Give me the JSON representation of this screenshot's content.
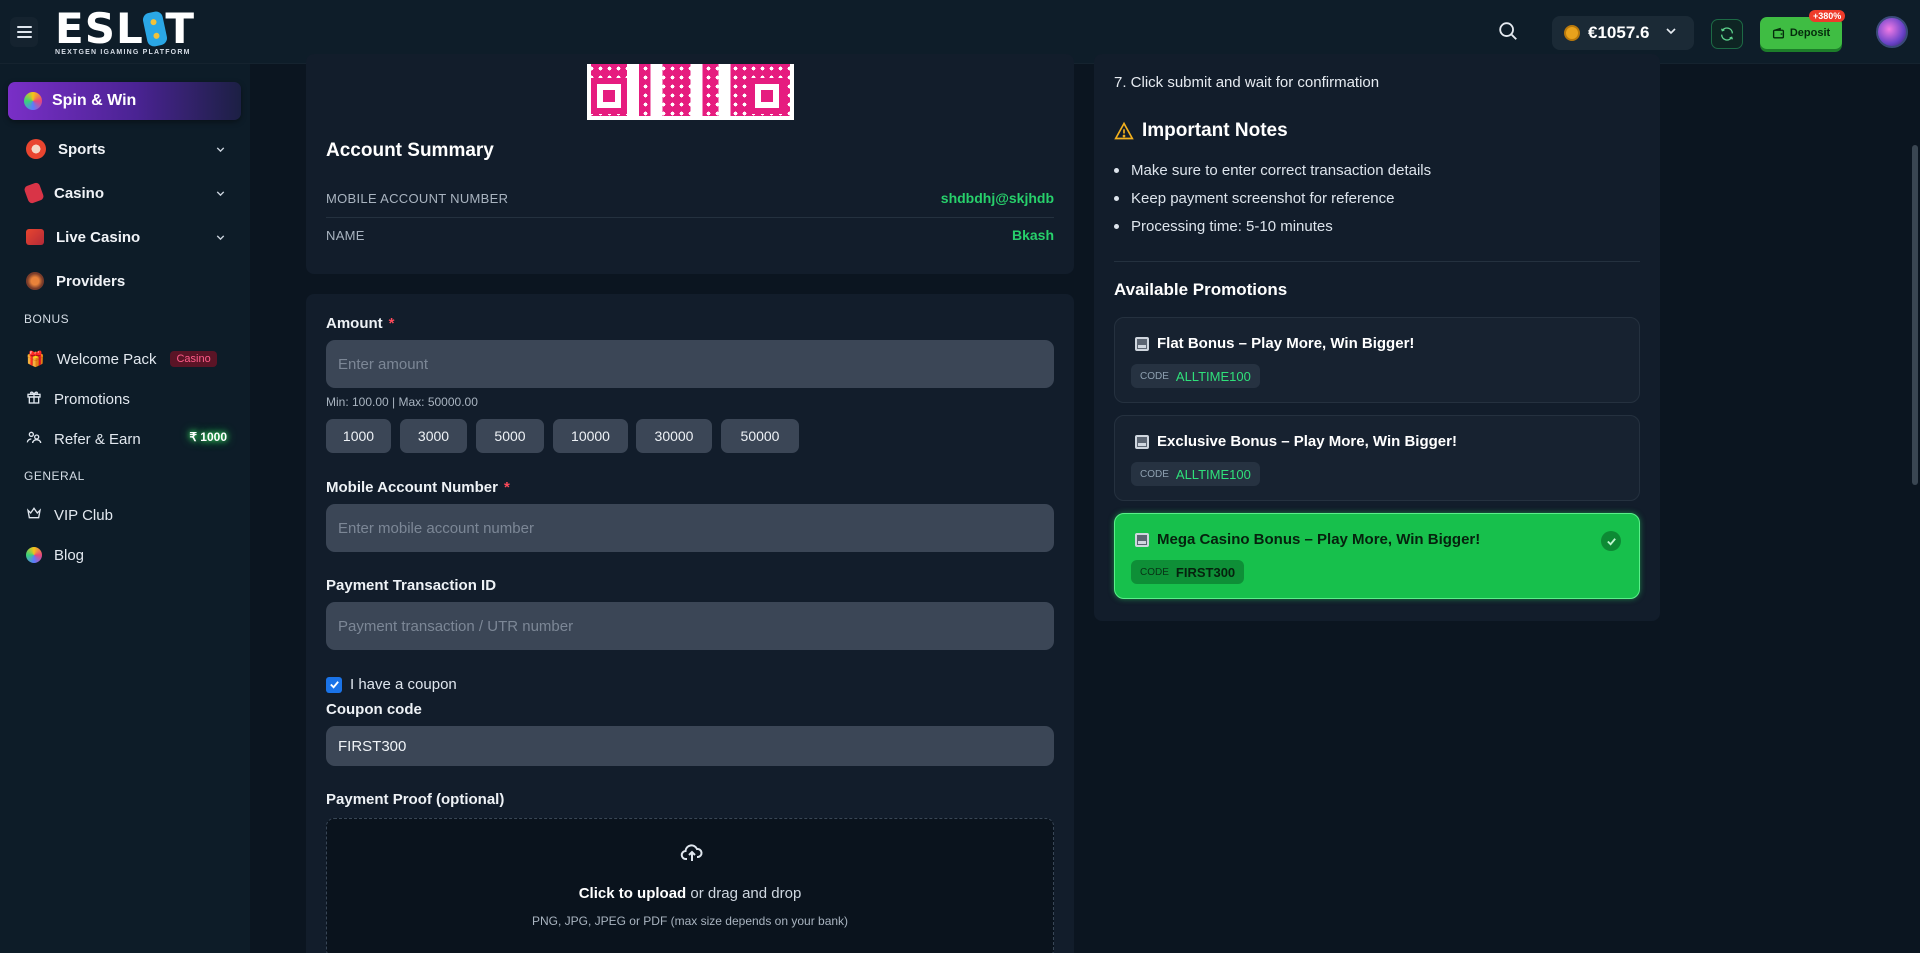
{
  "header": {
    "logo_text": "ESL",
    "logo_text_end": "T",
    "logo_tagline": "NEXTGEN IGAMING PLATFORM",
    "balance": "€1057.6",
    "deposit_label": "Deposit",
    "deposit_badge": "+380%"
  },
  "sidebar": {
    "spin_win": "Spin & Win",
    "items": [
      {
        "label": "Sports"
      },
      {
        "label": "Casino"
      },
      {
        "label": "Live Casino"
      },
      {
        "label": "Providers"
      }
    ],
    "bonus_section": "BONUS",
    "welcome_pack": "Welcome Pack",
    "welcome_tag": "Casino",
    "promotions": "Promotions",
    "refer_earn": "Refer & Earn",
    "refer_amount": "₹ 1000",
    "general_section": "GENERAL",
    "vip_club": "VIP Club",
    "blog": "Blog"
  },
  "summary": {
    "title": "Account Summary",
    "rows": [
      {
        "label": "MOBILE ACCOUNT NUMBER",
        "value": "shdbdhj@skjhdb"
      },
      {
        "label": "NAME",
        "value": "Bkash"
      }
    ]
  },
  "form": {
    "amount_label": "Amount",
    "required_mark": "*",
    "amount_placeholder": "Enter amount",
    "amount_hint": "Min: 100.00 | Max: 50000.00",
    "chips": [
      "1000",
      "3000",
      "5000",
      "10000",
      "30000",
      "50000"
    ],
    "mobile_label": "Mobile Account Number",
    "mobile_placeholder": "Enter mobile account number",
    "txn_label": "Payment Transaction ID",
    "txn_placeholder": "Payment transaction / UTR number",
    "coupon_check_label": "I have a coupon",
    "coupon_label": "Coupon code",
    "coupon_value": "FIRST300",
    "proof_label": "Payment Proof (optional)",
    "upload_bold": "Click to upload",
    "upload_rest": " or drag and drop",
    "upload_sub": "PNG, JPG, JPEG or PDF (max size depends on your bank)"
  },
  "instructions": {
    "step7": "7. Click submit and wait for confirmation",
    "notes_title": "Important Notes",
    "notes": [
      "Make sure to enter correct transaction details",
      "Keep payment screenshot for reference",
      "Processing time: 5-10 minutes"
    ],
    "promos_title": "Available Promotions",
    "code_label": "CODE",
    "promos": [
      {
        "title": "Flat Bonus – Play More, Win Bigger!",
        "code": "ALLTIME100"
      },
      {
        "title": "Exclusive Bonus – Play More, Win Bigger!",
        "code": "ALLTIME100"
      },
      {
        "title": "Mega Casino Bonus – Play More, Win Bigger!",
        "code": "FIRST300"
      }
    ]
  },
  "colors": {
    "accent_green": "#27d06b",
    "active_promo": "#17c04c",
    "deposit": "#3fbd43",
    "required": "#ff4a5a"
  }
}
